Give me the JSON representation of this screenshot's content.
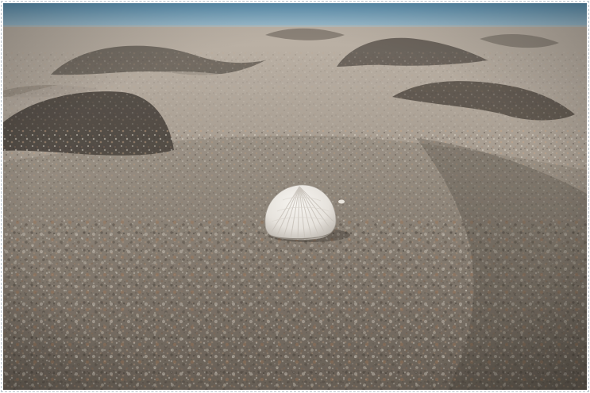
{
  "image": {
    "subject": "seashell",
    "colors": {
      "sea": "#4d86a8",
      "sea_light": "#8fb6cc",
      "sand_far": "#b8aea2",
      "sand_mid": "#978d82",
      "sand_near": "#6e655c",
      "shadow": "#4f4942",
      "shell": "#ece9e4",
      "shell_shade": "#bdb8b1",
      "frame_border": "#b9c3cc"
    }
  }
}
